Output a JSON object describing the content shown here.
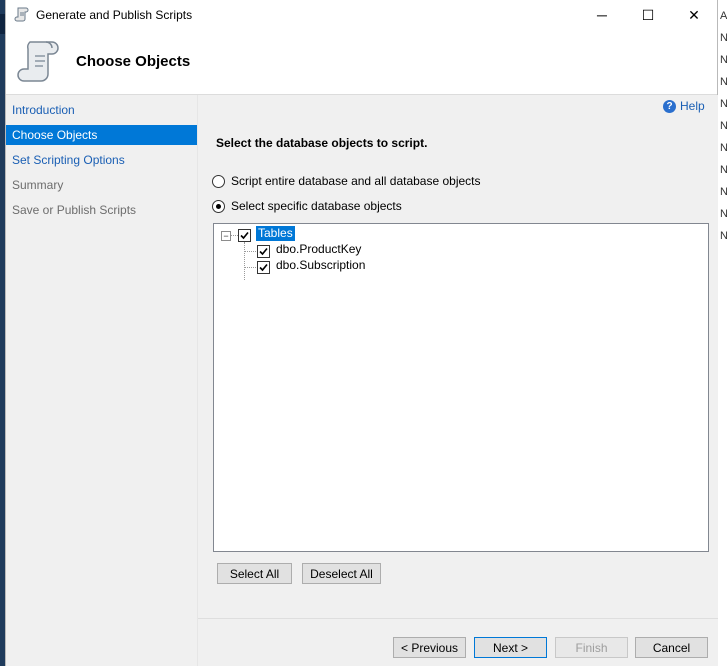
{
  "window": {
    "title": "Generate and Publish Scripts",
    "minimize_glyph": "─",
    "maximize_glyph": "☐",
    "close_glyph": "✕"
  },
  "header": {
    "title": "Choose Objects",
    "icon": "script-scroll-icon"
  },
  "sidebar": {
    "items": [
      {
        "label": "Introduction",
        "state": "link"
      },
      {
        "label": "Choose Objects",
        "state": "active"
      },
      {
        "label": "Set Scripting Options",
        "state": "link"
      },
      {
        "label": "Summary",
        "state": "disabled"
      },
      {
        "label": "Save or Publish Scripts",
        "state": "disabled"
      }
    ]
  },
  "content": {
    "help_label": "Help",
    "instruction": "Select the database objects to script.",
    "options": [
      {
        "label": "Script entire database and all database objects",
        "selected": false
      },
      {
        "label": "Select specific database objects",
        "selected": true
      }
    ],
    "tree": {
      "root": {
        "label": "Tables",
        "checked": true,
        "expanded": true
      },
      "children": [
        {
          "label": "dbo.ProductKey",
          "checked": true
        },
        {
          "label": "dbo.Subscription",
          "checked": true
        }
      ]
    },
    "select_all_label": "Select All",
    "deselect_all_label": "Deselect All"
  },
  "footer": {
    "previous_label": "< Previous",
    "next_label": "Next >",
    "finish_label": "Finish",
    "cancel_label": "Cancel"
  },
  "background_window": {
    "fragments": [
      "A",
      "N",
      "N",
      "N",
      "N",
      "N",
      "N",
      "N",
      "N",
      "N",
      "N"
    ]
  },
  "colors": {
    "accent": "#0078d7",
    "link": "#1a5fb4",
    "panel": "#f0f0f0"
  }
}
